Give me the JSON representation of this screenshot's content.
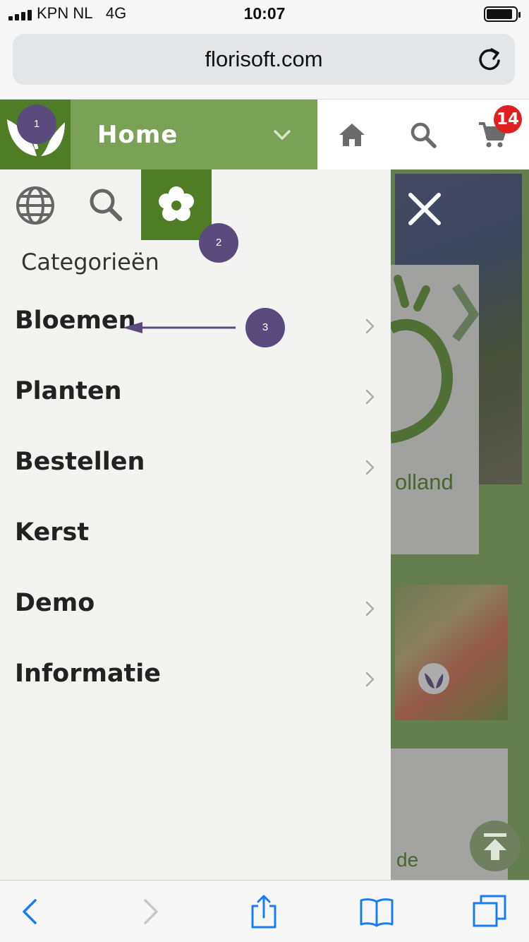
{
  "status_bar": {
    "carrier": "KPN NL",
    "network": "4G",
    "time": "10:07"
  },
  "browser": {
    "url": "florisoft.com"
  },
  "header": {
    "home_label": "Home",
    "cart_count": "14",
    "brand_color": "#4e7d26",
    "accent_color": "#7aa257",
    "badge_color": "#e02020"
  },
  "drawer": {
    "section_title": "Categorieën",
    "tabs": [
      {
        "icon": "globe-icon",
        "active": false
      },
      {
        "icon": "search-icon",
        "active": false
      },
      {
        "icon": "flower-icon",
        "active": true
      }
    ],
    "items": [
      {
        "label": "Bloemen",
        "has_children": true
      },
      {
        "label": "Planten",
        "has_children": true
      },
      {
        "label": "Bestellen",
        "has_children": true
      },
      {
        "label": "Kerst",
        "has_children": false
      },
      {
        "label": "Demo",
        "has_children": true
      },
      {
        "label": "Informatie",
        "has_children": true
      }
    ]
  },
  "background_page": {
    "card_text": "olland",
    "footer_text": "de"
  },
  "annotations": {
    "marker_1": "1",
    "marker_2": "2",
    "marker_3": "3",
    "marker_color": "#5b4a7e"
  }
}
